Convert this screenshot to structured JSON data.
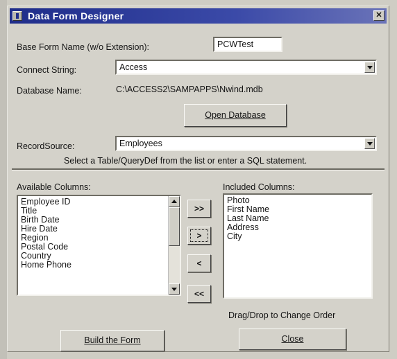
{
  "window": {
    "title": "Data Form Designer",
    "close_glyph": "✕"
  },
  "form": {
    "base_name_label": "Base Form Name (w/o Extension):",
    "base_name_value": "PCWTest",
    "connect_label": "Connect String:",
    "connect_value": "Access",
    "db_label": "Database Name:",
    "db_value": "C:\\ACCESS2\\SAMPAPPS\\Nwind.mdb",
    "open_db_button": "Open Database",
    "recordsource_label": "RecordSource:",
    "recordsource_value": "Employees",
    "hint": "Select a Table/QueryDef from the list or enter a SQL statement."
  },
  "available": {
    "label": "Available Columns:",
    "items": [
      "Employee ID",
      "Title",
      "Birth Date",
      "Hire Date",
      "Region",
      "Postal Code",
      "Country",
      "Home Phone"
    ]
  },
  "included": {
    "label": "Included Columns:",
    "items": [
      "Photo",
      "First Name",
      "Last Name",
      "Address",
      "City"
    ]
  },
  "move_buttons": {
    "add_all": ">>",
    "add_one": ">",
    "remove_one": "<",
    "remove_all": "<<"
  },
  "footer": {
    "drag_hint": "Drag/Drop to Change Order",
    "build_button": "Build the Form",
    "close_button": "Close"
  }
}
